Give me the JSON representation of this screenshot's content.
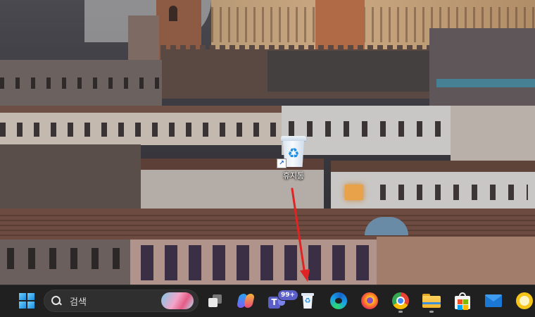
{
  "desktop": {
    "recycle_bin_label": "휴지통"
  },
  "taskbar": {
    "search": {
      "placeholder": "검색"
    },
    "teams": {
      "badge": "99+"
    },
    "icons": [
      "windows-start-icon",
      "search-icon",
      "task-view-icon",
      "copilot-icon",
      "teams-icon",
      "recycle-bin-icon",
      "edge-icon",
      "firefox-icon",
      "chrome-icon",
      "file-explorer-icon",
      "microsoft-store-icon",
      "mail-icon",
      "app-icon"
    ]
  },
  "annotation": {
    "arrow_color": "#e02424"
  }
}
